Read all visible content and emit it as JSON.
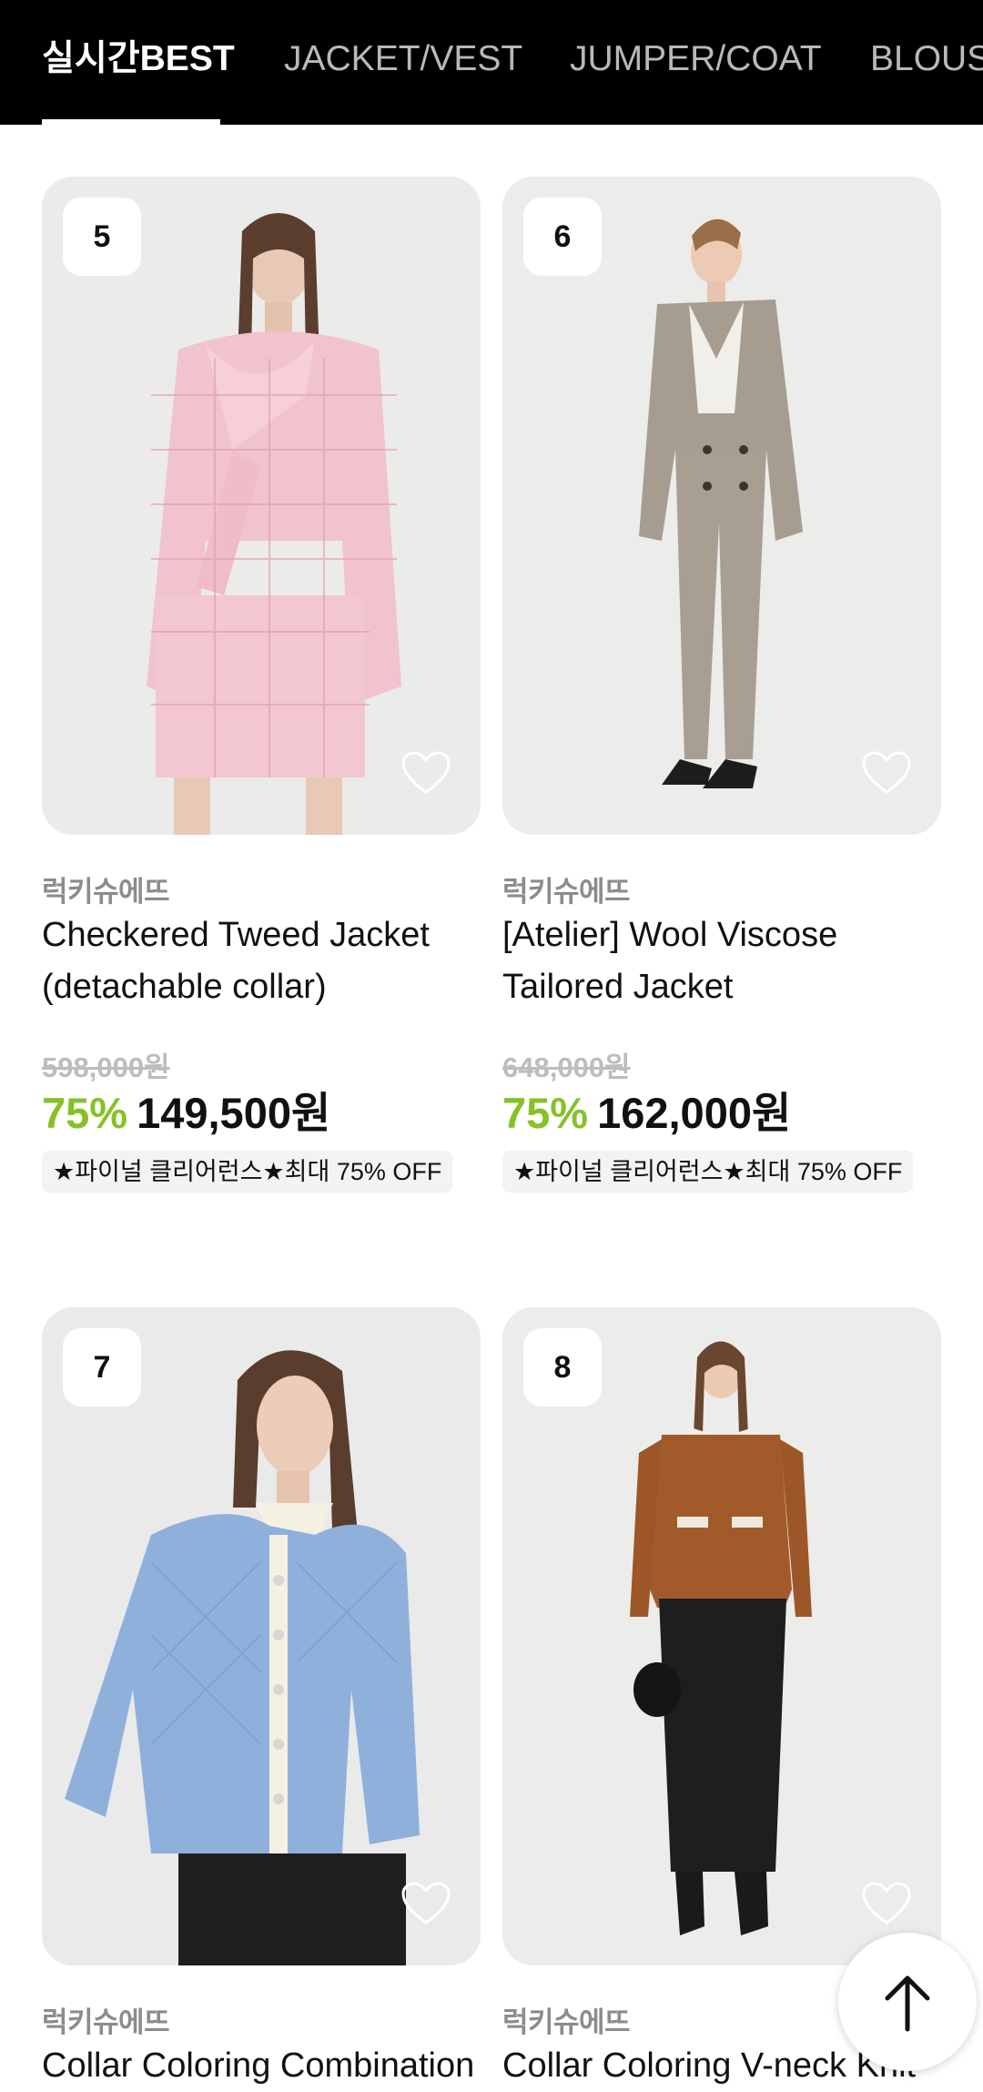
{
  "tabs": [
    {
      "label": "실시간BEST",
      "active": true
    },
    {
      "label": "JACKET/VEST",
      "active": false
    },
    {
      "label": "JUMPER/COAT",
      "active": false
    },
    {
      "label": "BLOUS",
      "active": false
    }
  ],
  "products": [
    {
      "rank": "5",
      "brand": "럭키슈에뜨",
      "name": "Checkered Tweed Jacket (detachable collar)",
      "original_price": "598,000원",
      "discount": "75%",
      "price": "149,500원",
      "badge": "★파이널 클리어런스★최대 75% OFF",
      "liked": false
    },
    {
      "rank": "6",
      "brand": "럭키슈에뜨",
      "name": "[Atelier] Wool Viscose Tailored Jacket",
      "original_price": "648,000원",
      "discount": "75%",
      "price": "162,000원",
      "badge": "★파이널 클리어런스★최대 75% OFF",
      "liked": false
    },
    {
      "rank": "7",
      "brand": "럭키슈에뜨",
      "name": "Collar Coloring Combination",
      "liked": false
    },
    {
      "rank": "8",
      "brand": "럭키슈에뜨",
      "name": "Collar Coloring V-neck Knit",
      "liked": false
    }
  ],
  "colors": {
    "header_bg": "#000000",
    "discount": "#86c227",
    "brand_text": "#8c8c8c",
    "card_bg": "#ededeb"
  },
  "icons": {
    "like": "heart-outline-icon",
    "scroll_top": "arrow-up-icon"
  }
}
